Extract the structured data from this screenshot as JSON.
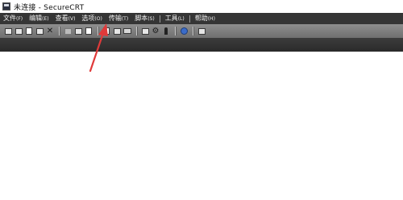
{
  "window": {
    "title": "未连接 - SecureCRT",
    "icon": "securecrt-app-icon"
  },
  "menu": [
    {
      "label": "文件",
      "acc": "(F)"
    },
    {
      "label": "编辑",
      "acc": "(E)"
    },
    {
      "label": "查看",
      "acc": "(V)"
    },
    {
      "label": "选项",
      "acc": "(O)"
    },
    {
      "label": "传输",
      "acc": "(T)"
    },
    {
      "label": "脚本",
      "acc": "(S)"
    },
    {
      "label": "工具",
      "acc": "(L)"
    },
    {
      "label": "帮助",
      "acc": "(H)"
    }
  ],
  "toolbar": {
    "icons": [
      "connect-icon",
      "quick-connect-icon",
      "connect-tab-icon",
      "reconnect-icon",
      "disconnect-icon",
      "copy-icon",
      "paste-icon",
      "find-icon",
      "print-icon",
      "print-setup-icon",
      "print-screen-icon",
      "session-options-icon",
      "global-options-icon",
      "key-icon",
      "help-icon",
      "terminal-icon"
    ]
  },
  "annotation": {
    "color": "#e03a3a",
    "target": "menu-options"
  }
}
